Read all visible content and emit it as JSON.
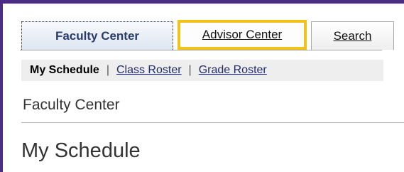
{
  "tabs": [
    {
      "label": "Faculty Center",
      "active": true
    },
    {
      "label": "Advisor Center",
      "highlighted": true
    },
    {
      "label": "Search"
    }
  ],
  "subnav": {
    "current": "My Schedule",
    "links": [
      "Class Roster",
      "Grade Roster"
    ],
    "separator": "|"
  },
  "breadcrumb": "Faculty Center",
  "page_title": "My Schedule",
  "colors": {
    "frame": "#4b2e83",
    "highlight": "#f0c21c",
    "link": "#1f2b6b"
  }
}
